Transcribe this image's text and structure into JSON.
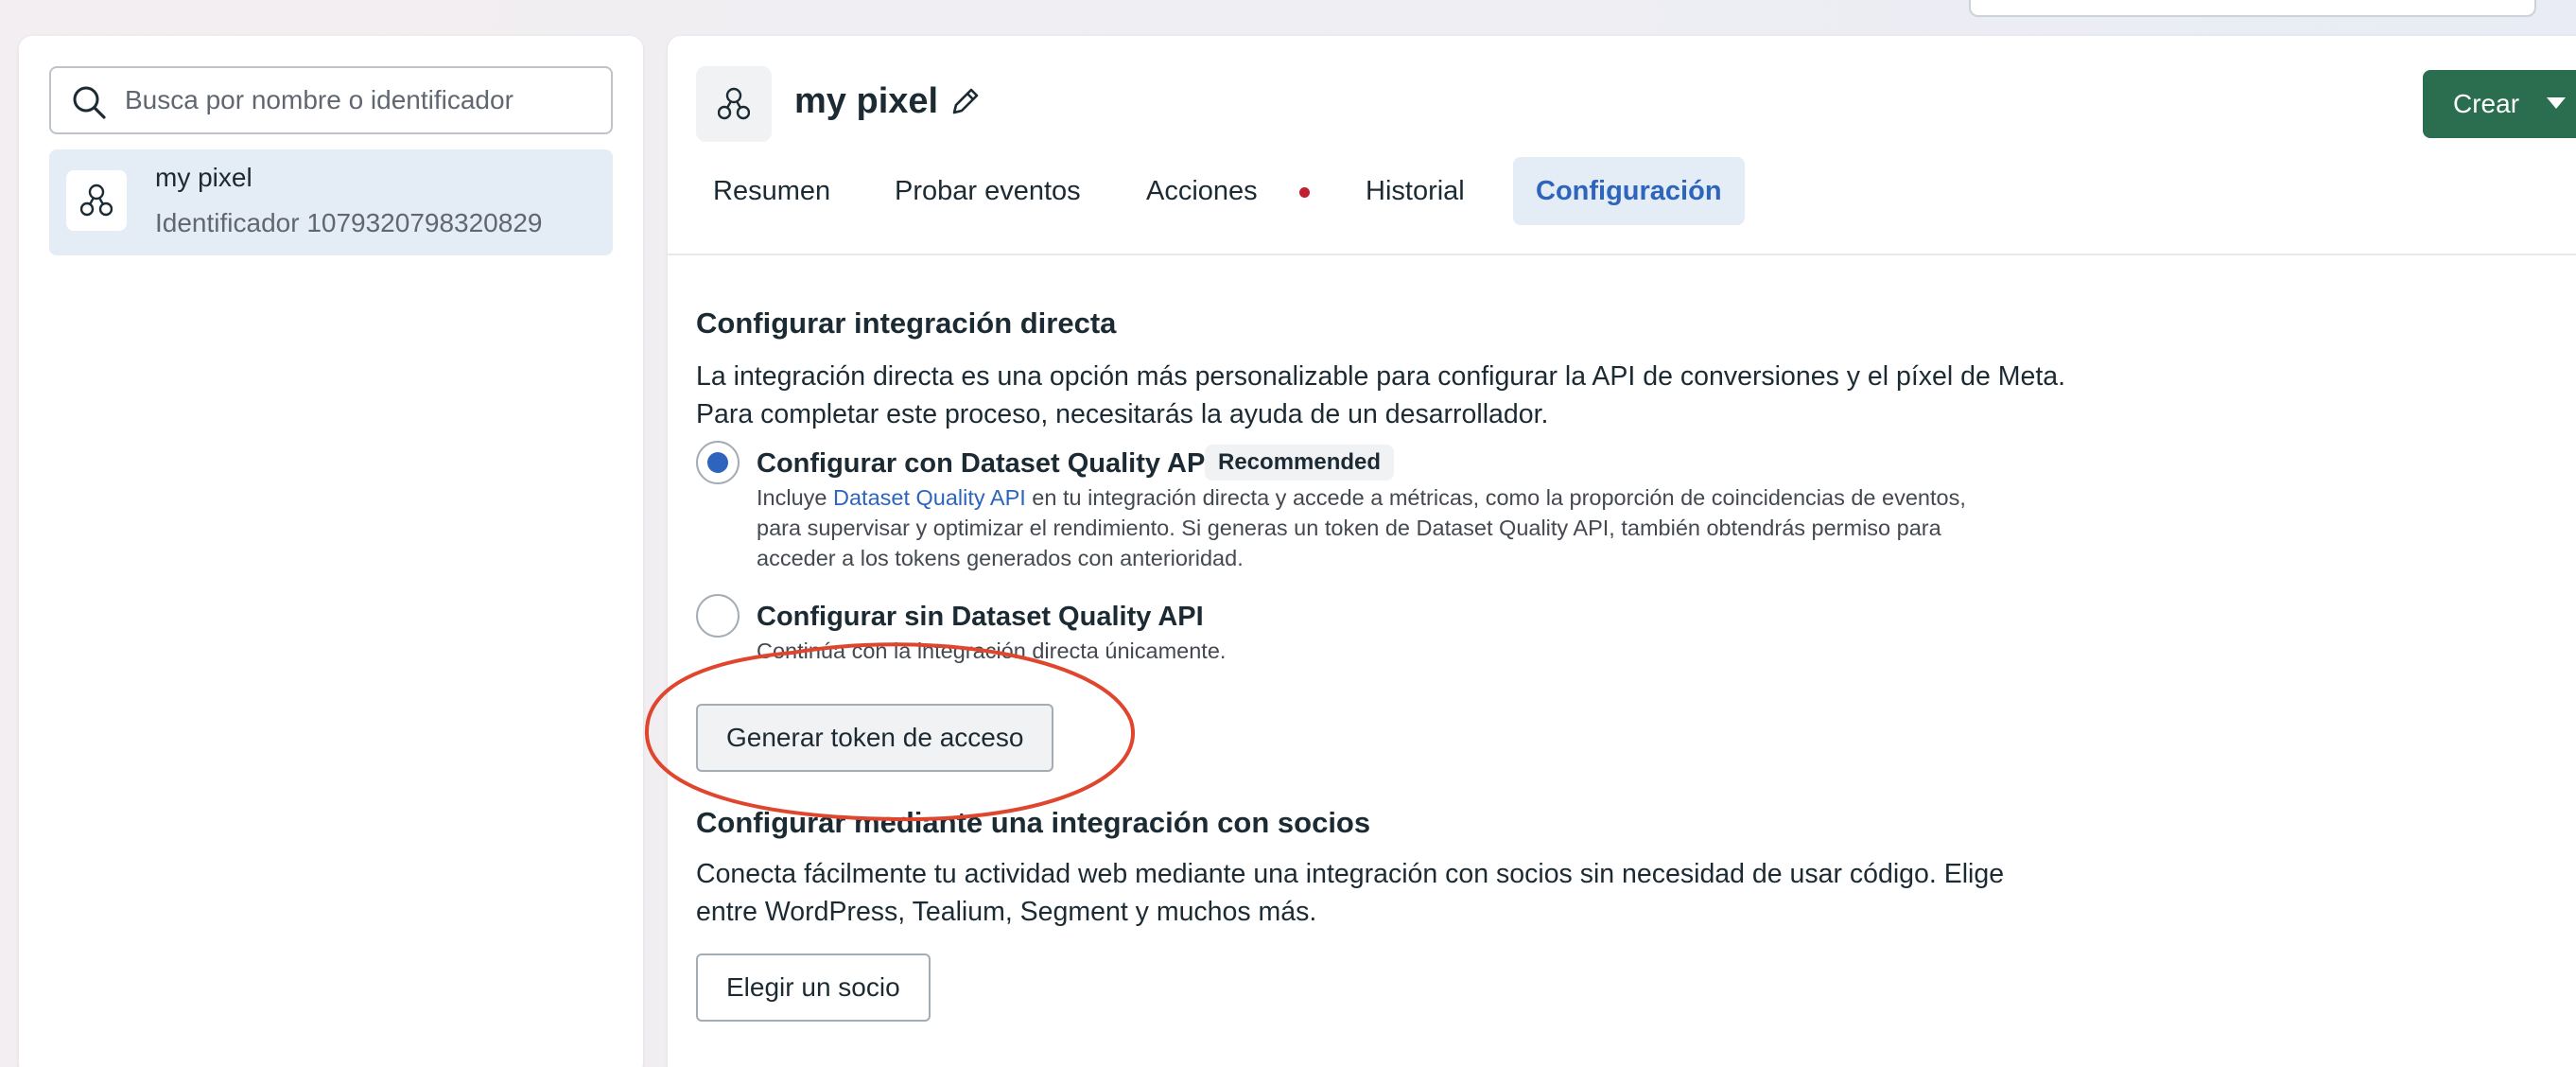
{
  "sidebar": {
    "search_placeholder": "Busca por nombre o identificador",
    "items": [
      {
        "name": "my pixel",
        "identifier": "Identificador 1079320798320829"
      }
    ]
  },
  "header": {
    "title": "my pixel",
    "create_label": "Crear"
  },
  "tabs": [
    {
      "label": "Resumen",
      "active": false
    },
    {
      "label": "Probar eventos",
      "active": false
    },
    {
      "label": "Acciones",
      "active": false,
      "notification": true
    },
    {
      "label": "Historial",
      "active": false
    },
    {
      "label": "Configuración",
      "active": true
    }
  ],
  "direct_integration": {
    "title": "Configurar integración directa",
    "description_line1": "La integración directa es una opción más personalizable para configurar la API de conversiones y el píxel de Meta.",
    "description_line2": "Para completar este proceso, necesitarás la ayuda de un desarrollador.",
    "options": [
      {
        "title": "Configurar con Dataset Quality API",
        "badge": "Recommended",
        "selected": true,
        "desc_prefix": "Incluye ",
        "desc_link": "Dataset Quality API",
        "desc_line1_rest": " en tu integración directa y accede a métricas, como la proporción de coincidencias de eventos,",
        "desc_line2": "para supervisar y optimizar el rendimiento. Si generas un token de Dataset Quality API, también obtendrás permiso para",
        "desc_line3": "acceder a los tokens generados con anterioridad."
      },
      {
        "title": "Configurar sin Dataset Quality API",
        "selected": false,
        "desc": "Continúa con la integración directa únicamente."
      }
    ],
    "button_label": "Generar token de acceso"
  },
  "partner_integration": {
    "title": "Configurar mediante una integración con socios",
    "description_line1": "Conecta fácilmente tu actividad web mediante una integración con socios sin necesidad de usar código. Elige",
    "description_line2": "entre WordPress, Tealium, Segment y muchos más.",
    "button_label": "Elegir un socio"
  },
  "colors": {
    "accent_blue": "#2d64bc",
    "create_green": "#2b6e4f",
    "selected_bg": "#e4ecf5",
    "notification_red": "#c21f33",
    "annotation_red": "#e0452d"
  },
  "icons": [
    "search-icon",
    "pixel-icon",
    "pencil-icon",
    "caret-down-icon"
  ]
}
